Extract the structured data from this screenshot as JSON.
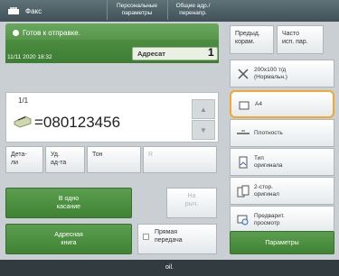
{
  "topbar": {
    "mode_label": "Факс",
    "personal_settings": "Персональные параметры",
    "shared_settings": "Общие адр./перенапр."
  },
  "status": {
    "ready": "Готов к отправке.",
    "datetime": "11/11 2020 18:32",
    "dest_label": "Адресат",
    "dest_count": "1"
  },
  "destination": {
    "page": "1/1",
    "number": "=080123456"
  },
  "left_grid": {
    "details": "Дета-\nли",
    "delete": "Уд.\nад-та",
    "tone": "Тон",
    "r": "R",
    "one_touch": "В одно\nкасание",
    "on_hook": "На\nрыч.",
    "address_book": "Адресная\nкнига",
    "direct_send": "Прямая\nпередача"
  },
  "right_panel": {
    "prev_settings": "Предыд.\nкорам.",
    "frequent": "Часто\nисп. пар.",
    "resolution": "200x100 т/д\n(Нормальн.)",
    "paper": "A4",
    "density": "Плотность",
    "original_type": "Тип\nоригинала",
    "two_sided": "2-стор.\nоригинал",
    "preview": "Предварит.\nпросмотр",
    "params": "Параметры"
  },
  "footer": {
    "text": "oil."
  },
  "colors": {
    "accent_green": "#4a8a3f",
    "highlight": "#f0a830"
  }
}
